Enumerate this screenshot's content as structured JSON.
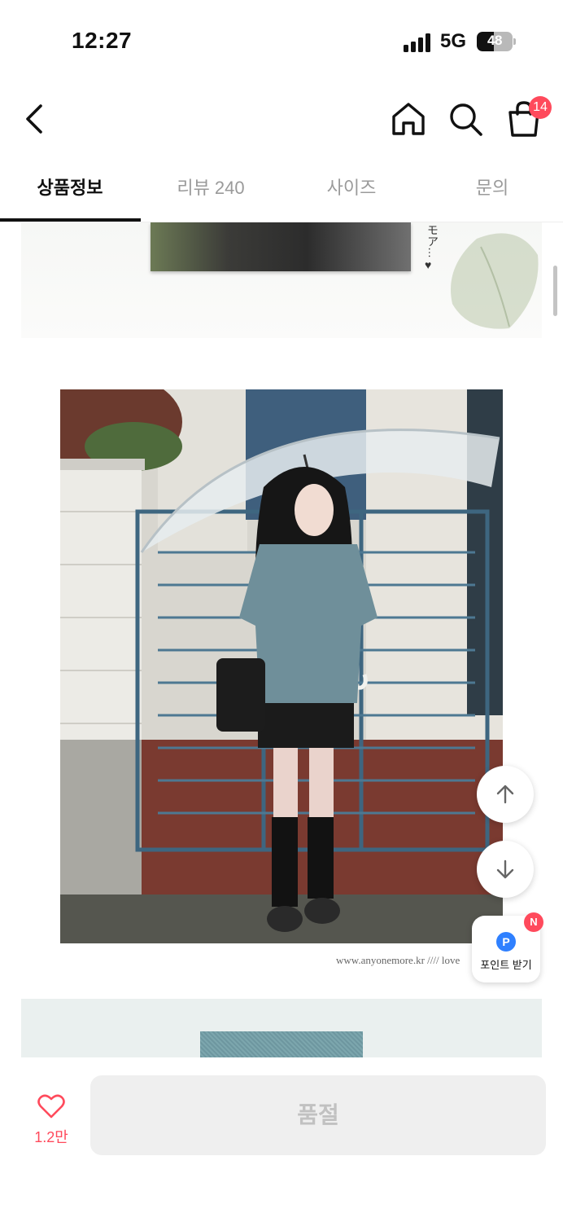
{
  "status_bar": {
    "time": "12:27",
    "network": "5G",
    "battery": "48",
    "battery_level": 0.48
  },
  "header": {
    "cart_count": "14",
    "icons": [
      "chevron-left-icon",
      "home-icon",
      "search-icon",
      "shopping-bag-icon"
    ]
  },
  "tabs": [
    {
      "label": "상품정보",
      "active": true
    },
    {
      "label": "리뷰 240",
      "active": false
    },
    {
      "label": "사이즈",
      "active": false
    },
    {
      "label": "문의",
      "active": false
    }
  ],
  "content": {
    "prev_vertical_text": "モア…",
    "photo_caption": "www.anyonemore.kr //// love"
  },
  "floating": {
    "points_label": "포인트 받기",
    "points_icon_text": "P",
    "new_badge": "N"
  },
  "bottom_bar": {
    "like_count": "1.2만",
    "soldout_label": "품절"
  },
  "colors": {
    "accent": "#ff4a5c",
    "points_blue": "#2f80ff",
    "active_tab": "#111111",
    "inactive_tab": "#9a9a9a",
    "disabled_button": "#efefef"
  }
}
